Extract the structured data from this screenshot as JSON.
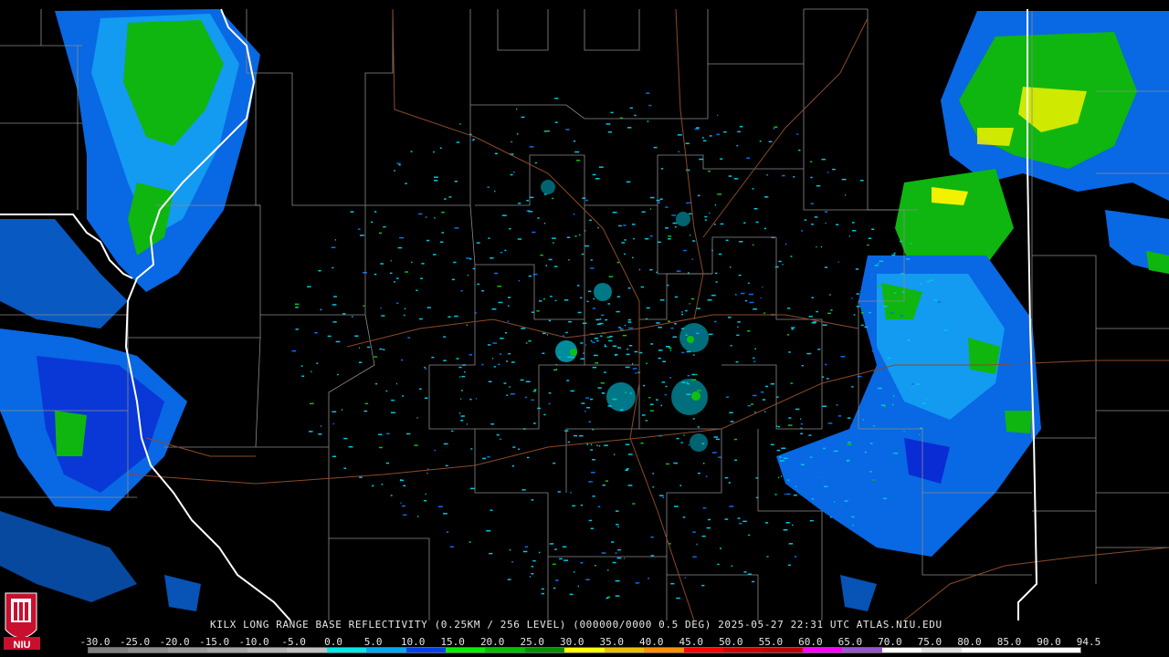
{
  "caption": "KILX LONG RANGE BASE REFLECTIVITY (0.25KM / 256 LEVEL) (000000/0000 0.5 DEG) 2025-05-27 22:31 UTC  ATLAS.NIU.EDU",
  "logo": {
    "text": "NIU",
    "icon": "niu-shield-logo-icon",
    "color": "#c8102e"
  },
  "legend": {
    "ticks": [
      "-30.0",
      "-25.0",
      "-20.0",
      "-15.0",
      "-10.0",
      "-5.0",
      "0.0",
      "5.0",
      "10.0",
      "15.0",
      "20.0",
      "25.0",
      "30.0",
      "35.0",
      "40.0",
      "45.0",
      "50.0",
      "55.0",
      "60.0",
      "65.0",
      "70.0",
      "75.0",
      "80.0",
      "85.0",
      "90.0",
      "94.5"
    ],
    "colors": [
      "#7f7f7f",
      "#8c8c8c",
      "#999999",
      "#a6a6a6",
      "#b3b3b3",
      "#c0c0c0",
      "#00e8e8",
      "#00a8f0",
      "#0040f0",
      "#00f000",
      "#00c000",
      "#009000",
      "#ffff00",
      "#e8c000",
      "#ff9000",
      "#ff0000",
      "#d00000",
      "#c00000",
      "#ff00ff",
      "#9955c9",
      "#ffffff",
      "#e0e0e0",
      "#ffffff",
      "#ffffff",
      "#ffffff"
    ]
  },
  "map": {
    "state_border_color": "#ffffff",
    "county_border_color": "#8a8a8a",
    "highway_color": "#8b4a2a",
    "reflectivity_colors": {
      "light": "#0a8cf0",
      "dark_blue": "#0030e0",
      "green": "#00d000",
      "bright_green": "#30ff30",
      "yellow": "#ffff00",
      "cyan": "#00c8e0"
    }
  }
}
